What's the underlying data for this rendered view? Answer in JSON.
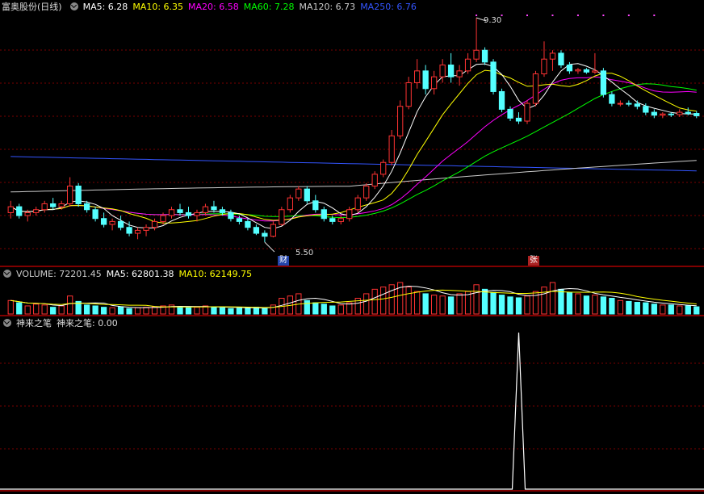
{
  "main_panel": {
    "stock_name": "富奥股份(日线)",
    "indicators": [
      {
        "label": "MA5: 6.28",
        "color": "#ffffff"
      },
      {
        "label": "MA10: 6.35",
        "color": "#ffff00"
      },
      {
        "label": "MA20: 6.58",
        "color": "#ff00ff"
      },
      {
        "label": "MA60: 7.28",
        "color": "#00ff00"
      },
      {
        "label": "MA120: 6.73",
        "color": "#cccccc"
      },
      {
        "label": "MA250: 6.76",
        "color": "#3355ff"
      }
    ],
    "high_label": "9.30",
    "low_label": "5.50",
    "event_tag_1": "财",
    "event_tag_2": "张"
  },
  "volume_panel": {
    "indicators": [
      {
        "label": "VOLUME: 72201.45",
        "color": "#cccccc"
      },
      {
        "label": "MA5: 62801.38",
        "color": "#ffffff"
      },
      {
        "label": "MA10: 62149.75",
        "color": "#ffff00"
      }
    ]
  },
  "indicator_panel": {
    "name": "神来之笔",
    "value_label": "神来之笔: 0.00"
  },
  "colors": {
    "up": "#ff3333",
    "down": "#54ffff",
    "grid": "#7a0000",
    "border": "#aa0000"
  },
  "chart_data": {
    "type": "candlestick",
    "price_range": [
      5.5,
      9.3
    ],
    "candles": [
      [
        6.0,
        6.2,
        5.9,
        6.1
      ],
      [
        6.1,
        6.15,
        5.9,
        5.95
      ],
      [
        5.95,
        6.05,
        5.85,
        6.0
      ],
      [
        6.0,
        6.1,
        5.95,
        6.05
      ],
      [
        6.05,
        6.2,
        6.0,
        6.15
      ],
      [
        6.15,
        6.25,
        6.05,
        6.1
      ],
      [
        6.1,
        6.2,
        6.05,
        6.15
      ],
      [
        6.15,
        6.6,
        6.1,
        6.45
      ],
      [
        6.45,
        6.5,
        6.1,
        6.15
      ],
      [
        6.15,
        6.2,
        6.0,
        6.05
      ],
      [
        6.05,
        6.1,
        5.85,
        5.9
      ],
      [
        5.9,
        6.0,
        5.75,
        5.8
      ],
      [
        5.8,
        5.9,
        5.7,
        5.85
      ],
      [
        5.85,
        5.95,
        5.7,
        5.75
      ],
      [
        5.75,
        5.85,
        5.6,
        5.65
      ],
      [
        5.65,
        5.75,
        5.55,
        5.7
      ],
      [
        5.7,
        5.8,
        5.6,
        5.75
      ],
      [
        5.75,
        5.9,
        5.7,
        5.85
      ],
      [
        5.85,
        6.0,
        5.8,
        5.95
      ],
      [
        5.95,
        6.1,
        5.9,
        6.05
      ],
      [
        6.05,
        6.15,
        5.95,
        6.0
      ],
      [
        6.0,
        6.1,
        5.9,
        5.95
      ],
      [
        5.95,
        6.05,
        5.85,
        6.0
      ],
      [
        6.0,
        6.15,
        5.95,
        6.1
      ],
      [
        6.1,
        6.2,
        6.0,
        6.05
      ],
      [
        6.05,
        6.1,
        5.95,
        6.0
      ],
      [
        6.0,
        6.05,
        5.85,
        5.9
      ],
      [
        5.9,
        5.95,
        5.8,
        5.85
      ],
      [
        5.85,
        5.9,
        5.7,
        5.75
      ],
      [
        5.75,
        5.8,
        5.62,
        5.65
      ],
      [
        5.65,
        5.7,
        5.5,
        5.6
      ],
      [
        5.6,
        5.85,
        5.58,
        5.8
      ],
      [
        5.8,
        6.1,
        5.78,
        6.05
      ],
      [
        6.05,
        6.3,
        6.0,
        6.25
      ],
      [
        6.25,
        6.45,
        6.2,
        6.4
      ],
      [
        6.4,
        6.45,
        6.15,
        6.2
      ],
      [
        6.2,
        6.3,
        6.0,
        6.05
      ],
      [
        6.05,
        6.1,
        5.85,
        5.9
      ],
      [
        5.9,
        5.95,
        5.8,
        5.85
      ],
      [
        5.85,
        5.95,
        5.8,
        5.9
      ],
      [
        5.9,
        6.1,
        5.85,
        6.05
      ],
      [
        6.05,
        6.3,
        6.0,
        6.25
      ],
      [
        6.25,
        6.5,
        6.2,
        6.45
      ],
      [
        6.45,
        6.7,
        6.4,
        6.65
      ],
      [
        6.65,
        6.9,
        6.6,
        6.85
      ],
      [
        6.85,
        7.4,
        6.8,
        7.3
      ],
      [
        7.3,
        7.9,
        7.25,
        7.8
      ],
      [
        7.8,
        8.3,
        7.75,
        8.2
      ],
      [
        8.2,
        8.6,
        8.1,
        8.4
      ],
      [
        8.4,
        8.5,
        8.0,
        8.1
      ],
      [
        8.1,
        8.4,
        8.0,
        8.3
      ],
      [
        8.3,
        8.6,
        8.2,
        8.5
      ],
      [
        8.5,
        8.7,
        8.2,
        8.3
      ],
      [
        8.3,
        8.5,
        8.15,
        8.4
      ],
      [
        8.4,
        8.7,
        8.35,
        8.6
      ],
      [
        8.6,
        9.3,
        8.55,
        8.75
      ],
      [
        8.75,
        8.8,
        8.5,
        8.55
      ],
      [
        8.55,
        8.6,
        8.0,
        8.05
      ],
      [
        8.05,
        8.1,
        7.7,
        7.75
      ],
      [
        7.75,
        7.8,
        7.55,
        7.6
      ],
      [
        7.6,
        7.7,
        7.5,
        7.55
      ],
      [
        7.55,
        7.9,
        7.5,
        7.85
      ],
      [
        7.85,
        8.4,
        7.8,
        8.35
      ],
      [
        8.35,
        8.9,
        8.3,
        8.6
      ],
      [
        8.6,
        8.75,
        8.4,
        8.7
      ],
      [
        8.7,
        8.75,
        8.45,
        8.5
      ],
      [
        8.5,
        8.55,
        8.35,
        8.4
      ],
      [
        8.4,
        8.45,
        8.35,
        8.42
      ],
      [
        8.42,
        8.45,
        8.35,
        8.38
      ],
      [
        8.38,
        8.7,
        8.35,
        8.4
      ],
      [
        8.4,
        8.45,
        7.95,
        8.0
      ],
      [
        8.0,
        8.05,
        7.8,
        7.85
      ],
      [
        7.85,
        7.9,
        7.8,
        7.85
      ],
      [
        7.85,
        7.9,
        7.8,
        7.84
      ],
      [
        7.84,
        7.9,
        7.75,
        7.8
      ],
      [
        7.8,
        7.85,
        7.65,
        7.7
      ],
      [
        7.7,
        7.75,
        7.6,
        7.65
      ],
      [
        7.65,
        7.7,
        7.6,
        7.67
      ],
      [
        7.67,
        7.7,
        7.62,
        7.66
      ],
      [
        7.66,
        7.75,
        7.62,
        7.7
      ],
      [
        7.7,
        7.78,
        7.65,
        7.68
      ],
      [
        7.68,
        7.72,
        7.6,
        7.64
      ]
    ],
    "volume": [
      30,
      25,
      18,
      22,
      20,
      15,
      18,
      40,
      28,
      20,
      18,
      15,
      14,
      16,
      12,
      14,
      15,
      16,
      18,
      20,
      16,
      14,
      15,
      18,
      16,
      14,
      12,
      13,
      14,
      15,
      12,
      20,
      35,
      40,
      45,
      30,
      25,
      22,
      18,
      20,
      25,
      35,
      45,
      55,
      60,
      65,
      70,
      60,
      50,
      45,
      42,
      40,
      38,
      45,
      50,
      65,
      55,
      48,
      42,
      38,
      36,
      40,
      50,
      60,
      70,
      55,
      48,
      45,
      40,
      42,
      38,
      35,
      30,
      28,
      26,
      25,
      22,
      20,
      20,
      18,
      18,
      16
    ],
    "indicator_spike_index": 60,
    "indicator_value": 0.0
  }
}
